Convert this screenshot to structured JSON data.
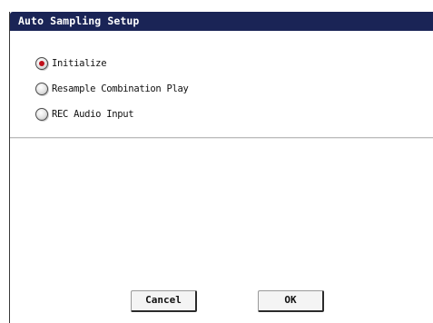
{
  "dialog": {
    "title": "Auto Sampling Setup"
  },
  "options": [
    {
      "label": "Initialize",
      "checked": true
    },
    {
      "label": "Resample Combination Play",
      "checked": false
    },
    {
      "label": "REC Audio Input",
      "checked": false
    }
  ],
  "buttons": {
    "cancel": "Cancel",
    "ok": "OK"
  },
  "colors": {
    "titlebar": "#1a2456",
    "radio_selected": "#c0101b"
  }
}
